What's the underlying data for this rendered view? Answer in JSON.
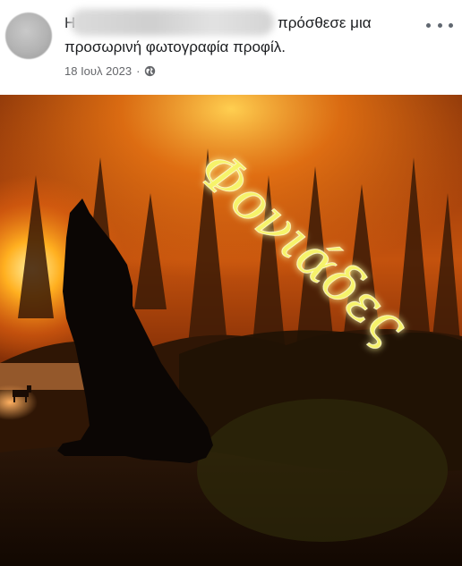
{
  "post": {
    "author_initial": "Η",
    "action_line_1": "πρόσθεσε μια",
    "action_line_2": "προσωρινή φωτογραφία προφίλ.",
    "date": "18 Ιουλ 2023",
    "separator": "·",
    "privacy_icon": "globe-icon",
    "more_icon": "more-options-icon"
  },
  "photo": {
    "overlay_text": "Φονιάδες",
    "overlay_color": "#f6f36a",
    "scene": "burning forest with silhouette of howling wolf"
  }
}
